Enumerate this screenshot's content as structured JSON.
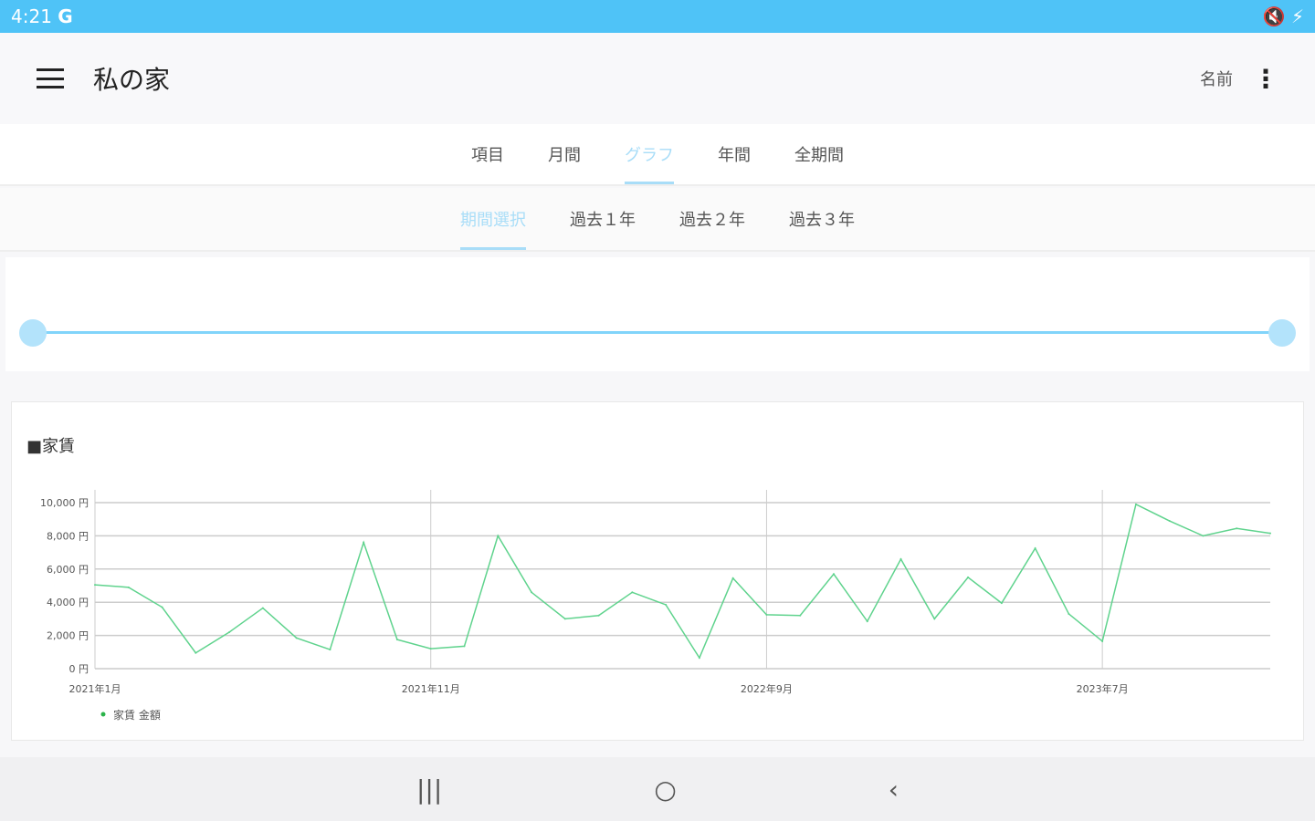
{
  "status_bar": {
    "time": "4:21",
    "google": "G",
    "icons": "🔇 ⚡"
  },
  "app_bar": {
    "title": "私の家",
    "name_button": "名前",
    "more": "⋮"
  },
  "main_tabs": [
    {
      "label": "項目"
    },
    {
      "label": "月間"
    },
    {
      "label": "グラフ",
      "active": true
    },
    {
      "label": "年間"
    },
    {
      "label": "全期間"
    }
  ],
  "period_tabs": [
    {
      "label": "期間選択",
      "active": true
    },
    {
      "label": "過去１年"
    },
    {
      "label": "過去２年"
    },
    {
      "label": "過去３年"
    }
  ],
  "range_slider": {
    "min": 0,
    "max": 1,
    "low": 0,
    "high": 1
  },
  "card_title": "■家賃",
  "chart_data": {
    "type": "line",
    "title": "■家賃",
    "x": [
      "2021-01",
      "2021-02",
      "2021-03",
      "2021-04",
      "2021-05",
      "2021-06",
      "2021-07",
      "2021-08",
      "2021-09",
      "2021-10",
      "2021-11",
      "2021-12",
      "2022-01",
      "2022-02",
      "2022-03",
      "2022-04",
      "2022-05",
      "2022-06",
      "2022-07",
      "2022-08",
      "2022-09",
      "2022-10",
      "2022-11",
      "2022-12",
      "2023-01",
      "2023-02",
      "2023-03",
      "2023-04",
      "2023-05",
      "2023-06",
      "2023-07",
      "2023-08",
      "2023-09",
      "2023-10",
      "2023-11",
      "2023-12"
    ],
    "x_tick_labels": [
      {
        "index": 0,
        "label": "2021年1月"
      },
      {
        "index": 10,
        "label": "2021年11月"
      },
      {
        "index": 20,
        "label": "2022年9月"
      },
      {
        "index": 30,
        "label": "2023年7月"
      }
    ],
    "y_ticks": [
      "0 円",
      "2,000 円",
      "4,000 円",
      "6,000 円",
      "8,000 円",
      "10,000 円"
    ],
    "ylim": [
      0,
      10000
    ],
    "series": [
      {
        "name": "家賃 金額",
        "color": "#5fd38d",
        "values": [
          5050,
          4900,
          3700,
          950,
          2200,
          3650,
          1850,
          1150,
          7600,
          1750,
          1200,
          1350,
          8000,
          4600,
          3000,
          3200,
          4600,
          3850,
          650,
          5450,
          3250,
          3200,
          5700,
          2850,
          6600,
          3000,
          5500,
          3950,
          7250,
          3300,
          1650,
          9900,
          8900,
          8000,
          8450,
          8150
        ]
      }
    ],
    "legend": "bottom-left",
    "grid": true
  },
  "nav_bar": {
    "recents": "|||",
    "home": "○",
    "back": "‹"
  }
}
